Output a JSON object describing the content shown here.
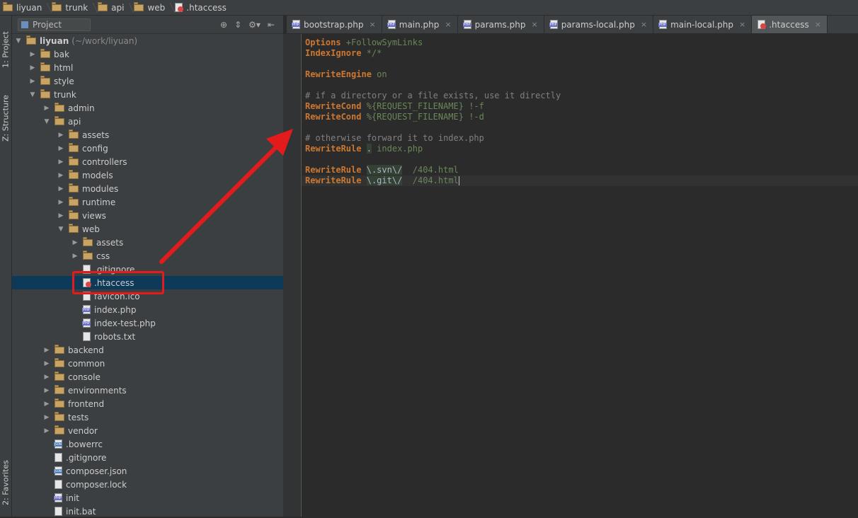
{
  "breadcrumb": [
    "liyuan",
    "trunk",
    "api",
    "web",
    ".htaccess"
  ],
  "left_strip": {
    "project_tab": "1: Project",
    "structure_tab": "Z: Structure",
    "favorites_tab": "2: Favorites"
  },
  "project_panel": {
    "label": "Project",
    "root_label": "liyuan",
    "root_hint": "(~/work/liyuan)",
    "tree": [
      {
        "label": "bak",
        "type": "folder",
        "depth": 1,
        "expanded": false
      },
      {
        "label": "html",
        "type": "folder",
        "depth": 1,
        "expanded": false
      },
      {
        "label": "style",
        "type": "folder",
        "depth": 1,
        "expanded": false
      },
      {
        "label": "trunk",
        "type": "folder",
        "depth": 1,
        "expanded": true
      },
      {
        "label": "admin",
        "type": "folder",
        "depth": 2,
        "expanded": false
      },
      {
        "label": "api",
        "type": "folder",
        "depth": 2,
        "expanded": true
      },
      {
        "label": "assets",
        "type": "folder",
        "depth": 3,
        "expanded": false
      },
      {
        "label": "config",
        "type": "folder",
        "depth": 3,
        "expanded": false
      },
      {
        "label": "controllers",
        "type": "folder",
        "depth": 3,
        "expanded": false
      },
      {
        "label": "models",
        "type": "folder",
        "depth": 3,
        "expanded": false
      },
      {
        "label": "modules",
        "type": "folder",
        "depth": 3,
        "expanded": false
      },
      {
        "label": "runtime",
        "type": "folder",
        "depth": 3,
        "expanded": false
      },
      {
        "label": "views",
        "type": "folder",
        "depth": 3,
        "expanded": false
      },
      {
        "label": "web",
        "type": "folder",
        "depth": 3,
        "expanded": true
      },
      {
        "label": "assets",
        "type": "folder",
        "depth": 4,
        "expanded": false
      },
      {
        "label": "css",
        "type": "folder",
        "depth": 4,
        "expanded": false
      },
      {
        "label": ".gitignore",
        "type": "file",
        "depth": 4
      },
      {
        "label": ".htaccess",
        "type": "ht",
        "depth": 4,
        "selected": true
      },
      {
        "label": "favicon.ico",
        "type": "file",
        "depth": 4
      },
      {
        "label": "index.php",
        "type": "php",
        "depth": 4
      },
      {
        "label": "index-test.php",
        "type": "php",
        "depth": 4
      },
      {
        "label": "robots.txt",
        "type": "file",
        "depth": 4
      },
      {
        "label": "backend",
        "type": "folder",
        "depth": 2,
        "expanded": false
      },
      {
        "label": "common",
        "type": "folder",
        "depth": 2,
        "expanded": false
      },
      {
        "label": "console",
        "type": "folder",
        "depth": 2,
        "expanded": false
      },
      {
        "label": "environments",
        "type": "folder",
        "depth": 2,
        "expanded": false
      },
      {
        "label": "frontend",
        "type": "folder",
        "depth": 2,
        "expanded": false
      },
      {
        "label": "tests",
        "type": "folder",
        "depth": 2,
        "expanded": false
      },
      {
        "label": "vendor",
        "type": "folder",
        "depth": 2,
        "expanded": false
      },
      {
        "label": ".bowerrc",
        "type": "json",
        "depth": 2
      },
      {
        "label": ".gitignore",
        "type": "file",
        "depth": 2
      },
      {
        "label": "composer.json",
        "type": "json",
        "depth": 2
      },
      {
        "label": "composer.lock",
        "type": "file",
        "depth": 2
      },
      {
        "label": "init",
        "type": "php",
        "depth": 2
      },
      {
        "label": "init.bat",
        "type": "file",
        "depth": 2
      }
    ]
  },
  "tabs": [
    {
      "label": "bootstrap.php",
      "type": "php",
      "active": false
    },
    {
      "label": "main.php",
      "type": "php",
      "active": false
    },
    {
      "label": "params.php",
      "type": "php",
      "active": false
    },
    {
      "label": "params-local.php",
      "type": "php",
      "active": false
    },
    {
      "label": "main-local.php",
      "type": "php",
      "active": false
    },
    {
      "label": ".htaccess",
      "type": "ht",
      "active": true
    }
  ],
  "editor_lines": [
    [
      {
        "t": "Options",
        "c": "kw"
      },
      {
        "t": " +FollowSymLinks",
        "c": "val"
      }
    ],
    [
      {
        "t": "IndexIgnore",
        "c": "kw"
      },
      {
        "t": " */*",
        "c": "val"
      }
    ],
    [],
    [
      {
        "t": "RewriteEngine",
        "c": "kw"
      },
      {
        "t": " on",
        "c": "val"
      }
    ],
    [],
    [
      {
        "t": "# if a directory or a file exists, use it directly",
        "c": "cmt"
      }
    ],
    [
      {
        "t": "RewriteCond",
        "c": "kw"
      },
      {
        "t": " %{REQUEST_FILENAME} !-f",
        "c": "val"
      }
    ],
    [
      {
        "t": "RewriteCond",
        "c": "kw"
      },
      {
        "t": " %{REQUEST_FILENAME} !-d",
        "c": "val"
      }
    ],
    [],
    [
      {
        "t": "# otherwise forward it to index.php",
        "c": "cmt"
      }
    ],
    [
      {
        "t": "RewriteRule",
        "c": "kw"
      },
      {
        "t": " ",
        "c": ""
      },
      {
        "t": ".",
        "c": "svn"
      },
      {
        "t": " index.php",
        "c": "val"
      }
    ],
    [],
    [
      {
        "t": "RewriteRule",
        "c": "kw"
      },
      {
        "t": " ",
        "c": ""
      },
      {
        "t": "\\.svn\\/",
        "c": "svn"
      },
      {
        "t": "  /404.html",
        "c": "val"
      }
    ],
    [
      {
        "t": "RewriteRule",
        "c": "kw"
      },
      {
        "t": " ",
        "c": ""
      },
      {
        "t": "\\.git\\/",
        "c": "svn"
      },
      {
        "t": "  /404.html",
        "c": "val"
      },
      {
        "t": "|",
        "c": "caret"
      }
    ]
  ]
}
